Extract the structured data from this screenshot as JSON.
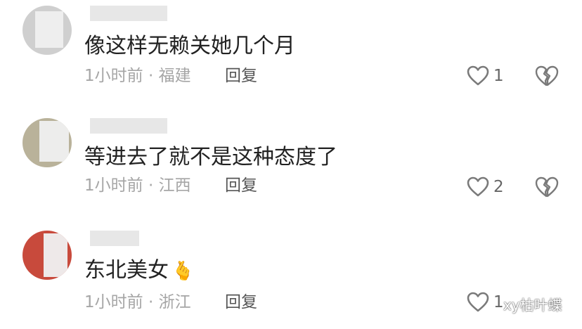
{
  "comments": [
    {
      "text": "像这样无赖关她几个月",
      "time": "1小时前",
      "separator": "·",
      "location": "福建",
      "reply_label": "回复",
      "likes": "1",
      "emoji": ""
    },
    {
      "text": "等进去了就不是这种态度了",
      "time": "1小时前",
      "separator": "·",
      "location": "江西",
      "reply_label": "回复",
      "likes": "2",
      "emoji": ""
    },
    {
      "text": "东北美女",
      "time": "1小时前",
      "separator": "·",
      "location": "浙江",
      "reply_label": "回复",
      "likes": "1",
      "emoji": "🫰"
    }
  ],
  "watermark": "xy枯叶蝶",
  "icons": {
    "like": "heart-outline-icon",
    "dislike": "broken-heart-icon"
  },
  "colors": {
    "text": "#222222",
    "meta": "#a6a6a6",
    "icon": "#7a7a7a"
  }
}
